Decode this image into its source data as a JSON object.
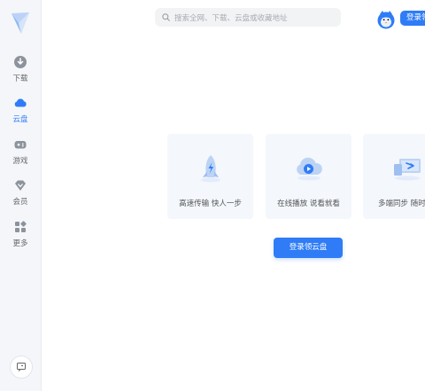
{
  "sidebar": {
    "items": [
      {
        "label": "下载",
        "icon": "download-icon"
      },
      {
        "label": "云盘",
        "icon": "cloud-icon"
      },
      {
        "label": "游戏",
        "icon": "gamepad-icon"
      },
      {
        "label": "会员",
        "icon": "diamond-icon"
      },
      {
        "label": "更多",
        "icon": "grid-icon"
      }
    ]
  },
  "header": {
    "search_placeholder": "搜索全网、下载、云盘或收藏地址",
    "login_label": "登录领"
  },
  "features": [
    {
      "caption": "高速传输 快人一步",
      "icon": "rocket-icon"
    },
    {
      "caption": "在线播放 说看就看",
      "icon": "cloud-play-icon"
    },
    {
      "caption": "多端同步 随时访",
      "icon": "devices-icon"
    }
  ],
  "cta_label": "登录领云盘",
  "colors": {
    "accent": "#2f7cf6",
    "sidebar_bg": "#f4f6fa"
  }
}
